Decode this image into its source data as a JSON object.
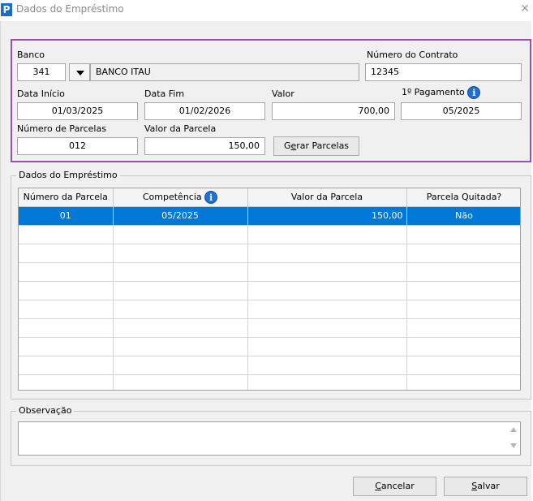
{
  "window": {
    "title": "Dados do Empréstimo",
    "app_icon": "P"
  },
  "form": {
    "banco_label": "Banco",
    "banco_code": "341",
    "banco_name": "BANCO ITAU",
    "contrato_label": "Número do Contrato",
    "contrato_value": "12345",
    "data_inicio_label": "Data Início",
    "data_inicio_value": "01/03/2025",
    "data_fim_label": "Data Fim",
    "data_fim_value": "01/02/2026",
    "valor_label": "Valor",
    "valor_value": "700,00",
    "primeiro_pagamento_label": "1º Pagamento",
    "primeiro_pagamento_value": "05/2025",
    "num_parcelas_label": "Número de Parcelas",
    "num_parcelas_value": "012",
    "valor_parcela_label": "Valor da Parcela",
    "valor_parcela_value": "150,00",
    "gerar_button": {
      "before": "G",
      "mnemonic": "e",
      "after": "rar Parcelas"
    }
  },
  "grid": {
    "group_title": "Dados do Empréstimo",
    "columns": [
      "Número da Parcela",
      "Competência",
      "Valor da Parcela",
      "Parcela Quitada?"
    ],
    "rows": [
      {
        "numero": "01",
        "competencia": "05/2025",
        "valor": "150,00",
        "quitada": "Não"
      }
    ]
  },
  "observacao": {
    "group_title": "Observação",
    "value": ""
  },
  "footer": {
    "cancel_button": {
      "mnemonic": "C",
      "rest": "ancelar"
    },
    "save_button": {
      "mnemonic": "S",
      "rest": "alvar"
    }
  },
  "colors": {
    "accent_selection": "#0078d7",
    "form_border": "#9b4fb0",
    "info_icon": "#1f6fd6"
  },
  "icons": [
    "app-icon",
    "close-icon",
    "dropdown-arrow-icon",
    "info-icon",
    "scroll-up-icon",
    "scroll-down-icon"
  ]
}
